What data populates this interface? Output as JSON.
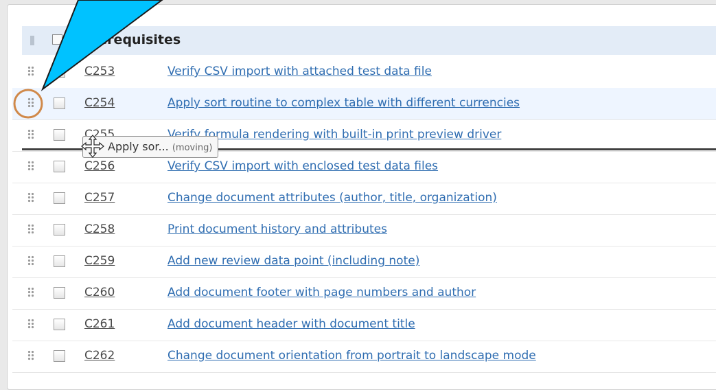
{
  "section": {
    "title": "Prerequisites"
  },
  "rows": [
    {
      "id": "C253",
      "title": "Verify CSV import with attached test data file"
    },
    {
      "id": "C254",
      "title": "Apply sort routine to complex table with different currencies"
    },
    {
      "id": "C255",
      "title": "Verify formula rendering with built-in print preview driver"
    },
    {
      "id": "C256",
      "title": "Verify CSV import with enclosed test data files"
    },
    {
      "id": "C257",
      "title": "Change document attributes (author, title, organization)"
    },
    {
      "id": "C258",
      "title": "Print document history and attributes"
    },
    {
      "id": "C259",
      "title": "Add new review data point (including note)"
    },
    {
      "id": "C260",
      "title": "Add document footer with page numbers and author"
    },
    {
      "id": "C261",
      "title": "Add document header with document title"
    },
    {
      "id": "C262",
      "title": "Change document orientation from portrait to landscape mode"
    }
  ],
  "drag_tooltip": {
    "label": "Apply sor...",
    "status": "(moving)"
  },
  "colors": {
    "callout_fill": "#00c2ff",
    "handle_highlight": "#d0894a",
    "link": "#2f6db1",
    "header_bg": "#e3ecf7"
  },
  "icons": {
    "drag_handle": "drag-handle-icon",
    "checkbox": "checkbox-icon",
    "move_cursor": "move-cursor-icon",
    "callout": "callout-arrow"
  }
}
